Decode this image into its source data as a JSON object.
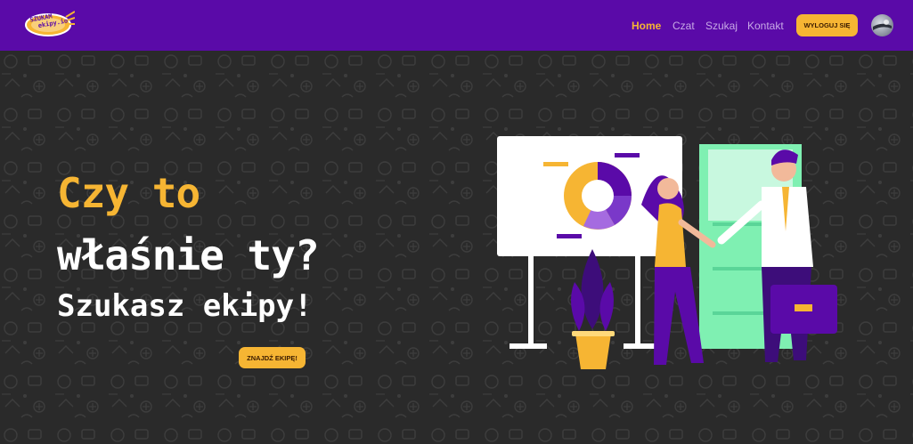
{
  "logo": {
    "line1": "SZUKAM",
    "line2": "ekipy.io"
  },
  "nav": {
    "items": [
      {
        "label": "Home",
        "active": true
      },
      {
        "label": "Czat",
        "active": false
      },
      {
        "label": "Szukaj",
        "active": false
      },
      {
        "label": "Kontakt",
        "active": false
      }
    ],
    "logout_label": "WYLOGUJ SIĘ"
  },
  "hero": {
    "line1": "Czy to",
    "line2": "właśnie ty?",
    "subtitle": "Szukasz ekipy!",
    "cta_label": "ZNAJDŹ EKIPĘ!"
  },
  "colors": {
    "navbar": "#5a0aa8",
    "accent": "#f6b533",
    "background": "#2a2a2a"
  },
  "icons": [
    "logo-blimp-icon",
    "avatar-icon",
    "presentation-illustration"
  ]
}
